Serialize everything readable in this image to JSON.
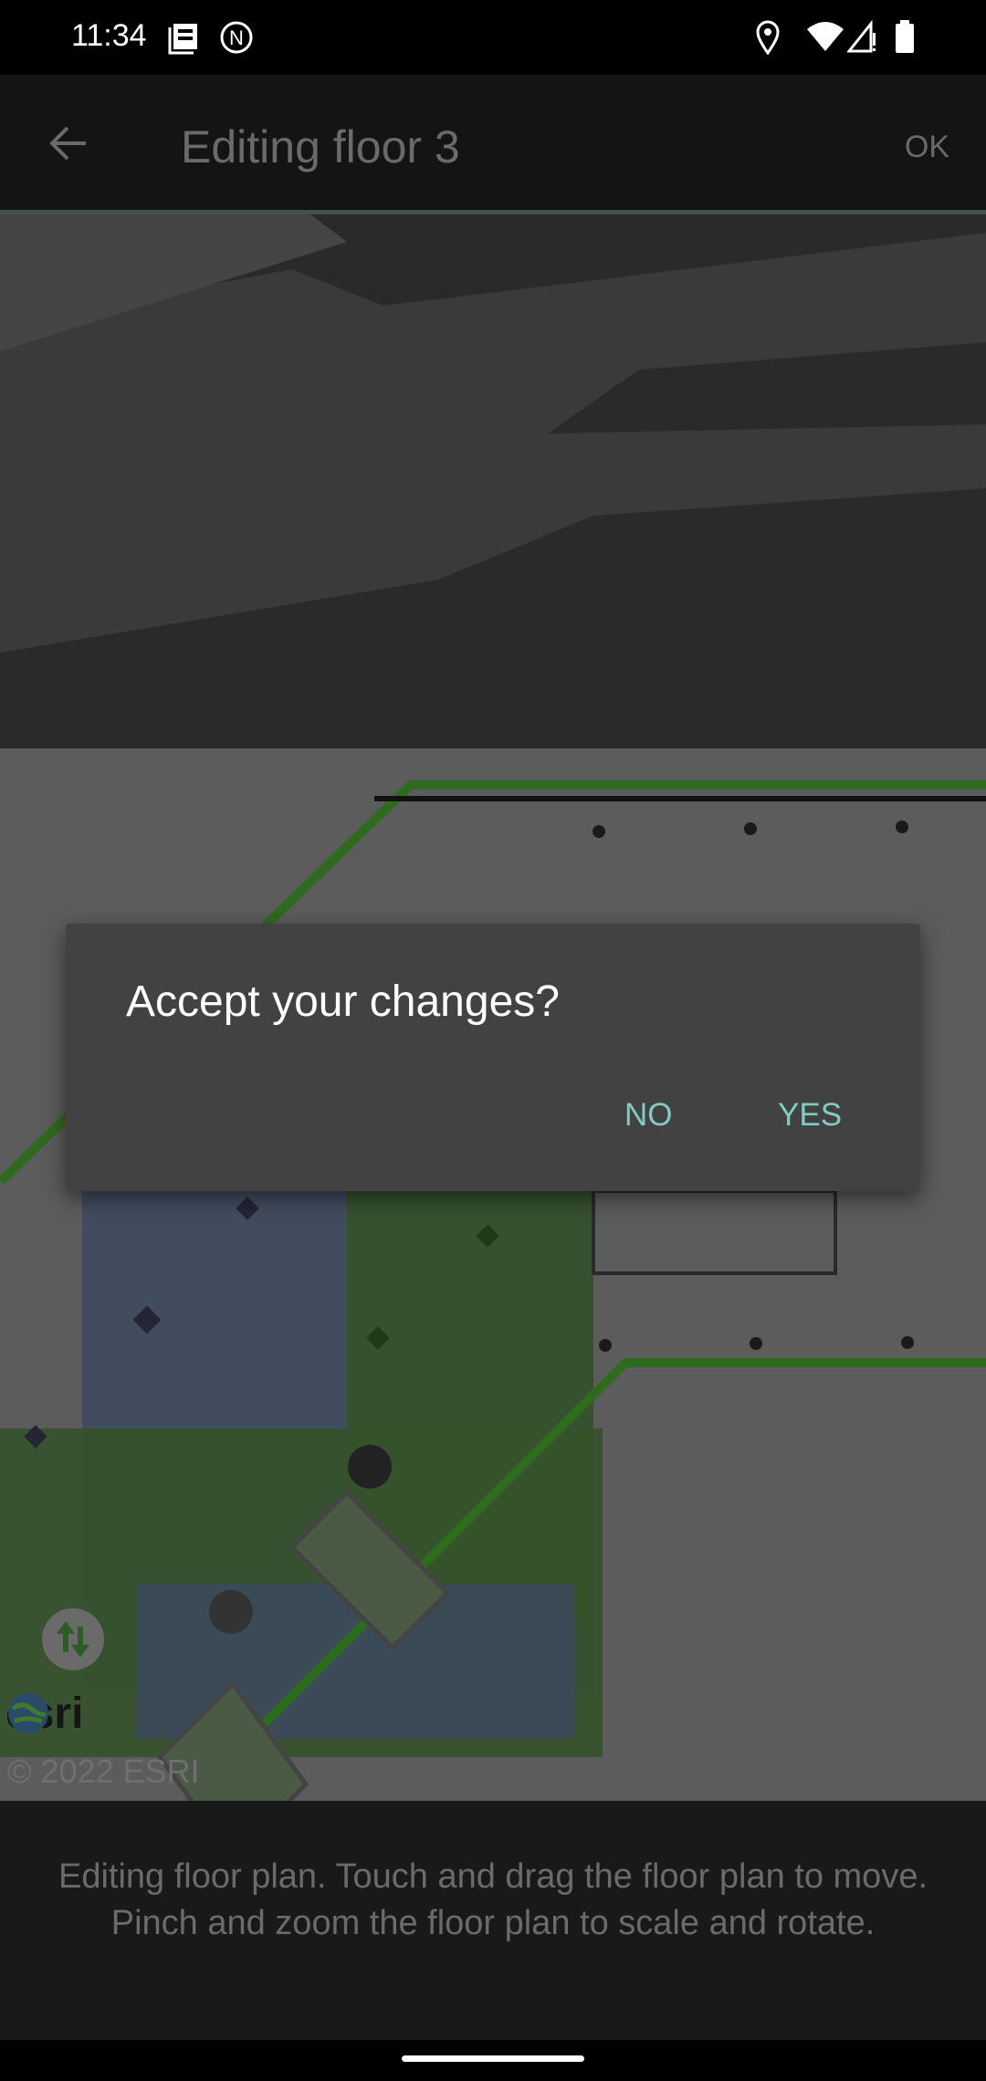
{
  "status_bar": {
    "time": "11:34",
    "icons": [
      "news-icon",
      "n-badge-icon",
      "location-icon",
      "wifi-icon",
      "signal-alert-icon",
      "battery-icon"
    ]
  },
  "toolbar": {
    "title": "Editing floor 3",
    "ok_label": "OK",
    "back_icon": "arrow-left-icon"
  },
  "map": {
    "attribution": "© 2022 ESRI",
    "logo": "esri",
    "accent": "#2e6b1f"
  },
  "dialog": {
    "title": "Accept your changes?",
    "no_label": "NO",
    "yes_label": "YES",
    "button_color": "#80cbc4"
  },
  "instructions": "Editing floor plan. Touch and drag the floor plan to move. Pinch and zoom the floor plan to scale and rotate."
}
